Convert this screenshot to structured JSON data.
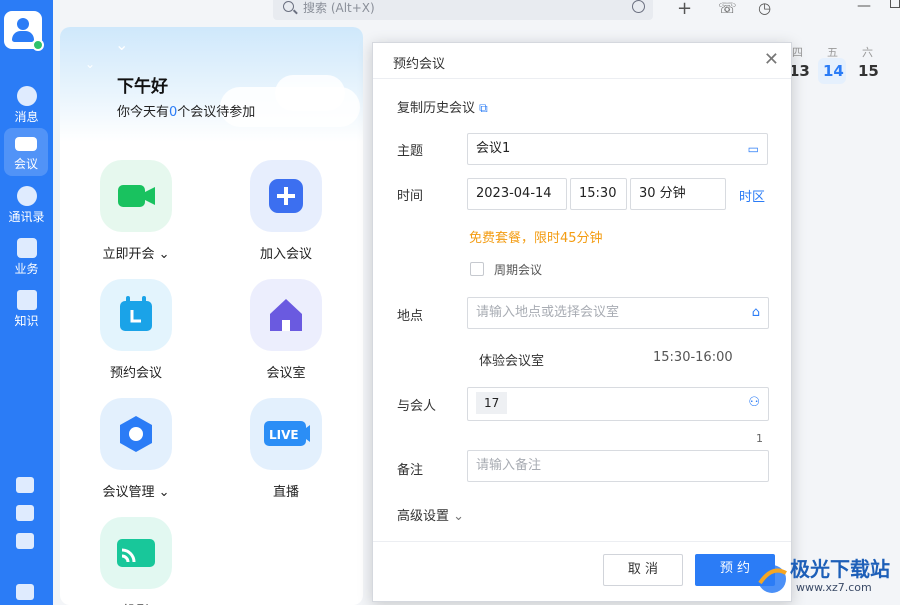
{
  "nav": {
    "items": [
      {
        "label": "消息",
        "icon": "chat-icon"
      },
      {
        "label": "会议",
        "icon": "video-camera-icon"
      },
      {
        "label": "通讯录",
        "icon": "contacts-icon"
      },
      {
        "label": "业务",
        "icon": "grid-apps-icon"
      },
      {
        "label": "知识",
        "icon": "book-icon"
      }
    ],
    "bottom_icons": [
      "calendar-icon",
      "cube-icon",
      "cast-icon",
      "building-icon"
    ]
  },
  "topbar": {
    "search_placeholder": "搜索 (Alt+X)"
  },
  "home": {
    "greeting": "下午好",
    "sub_prefix": "你今天有",
    "sub_count": "0",
    "sub_suffix": "个会议待参加",
    "tiles": [
      {
        "label": "立即开会",
        "icon": "video-camera-icon",
        "has_dropdown": true
      },
      {
        "label": "加入会议",
        "icon": "plus-icon",
        "has_dropdown": false
      },
      {
        "label": "预约会议",
        "icon": "calendar-icon",
        "has_dropdown": false
      },
      {
        "label": "会议室",
        "icon": "house-icon",
        "has_dropdown": false
      },
      {
        "label": "会议管理",
        "icon": "hexagon-icon",
        "has_dropdown": true
      },
      {
        "label": "直播",
        "icon": "live-icon",
        "has_dropdown": false
      },
      {
        "label": "投影",
        "icon": "cast-icon",
        "has_dropdown": false
      }
    ],
    "live_badge": "LIVE"
  },
  "calendar": {
    "weekdays": [
      "四",
      "五",
      "六"
    ],
    "days": [
      "13",
      "14",
      "15"
    ],
    "today": "14"
  },
  "dialog": {
    "title": "预约会议",
    "copy_history": "复制历史会议",
    "subject_label": "主题",
    "subject_value": "会议1",
    "time_label": "时间",
    "date": "2023-04-14",
    "start_time": "15:30",
    "duration": "30 分钟",
    "timezone": "时区",
    "free_plan_note": "免费套餐，限时45分钟",
    "recurring_label": "周期会议",
    "location_label": "地点",
    "location_placeholder": "请输入地点或选择会议室",
    "room_name": "体验会议室",
    "room_time": "15:30-16:00",
    "participants_label": "与会人",
    "participant_tag": "17",
    "participant_count": "1",
    "notes_label": "备注",
    "notes_placeholder": "请输入备注",
    "advanced_label": "高级设置",
    "cancel_label": "取 消",
    "submit_label": "预 约"
  },
  "watermark": {
    "text": "极光下载站",
    "url": "www.xz7.com"
  },
  "colors": {
    "accent": "#2b7cf6",
    "warning": "#f39c12",
    "green": "#19c25f"
  }
}
